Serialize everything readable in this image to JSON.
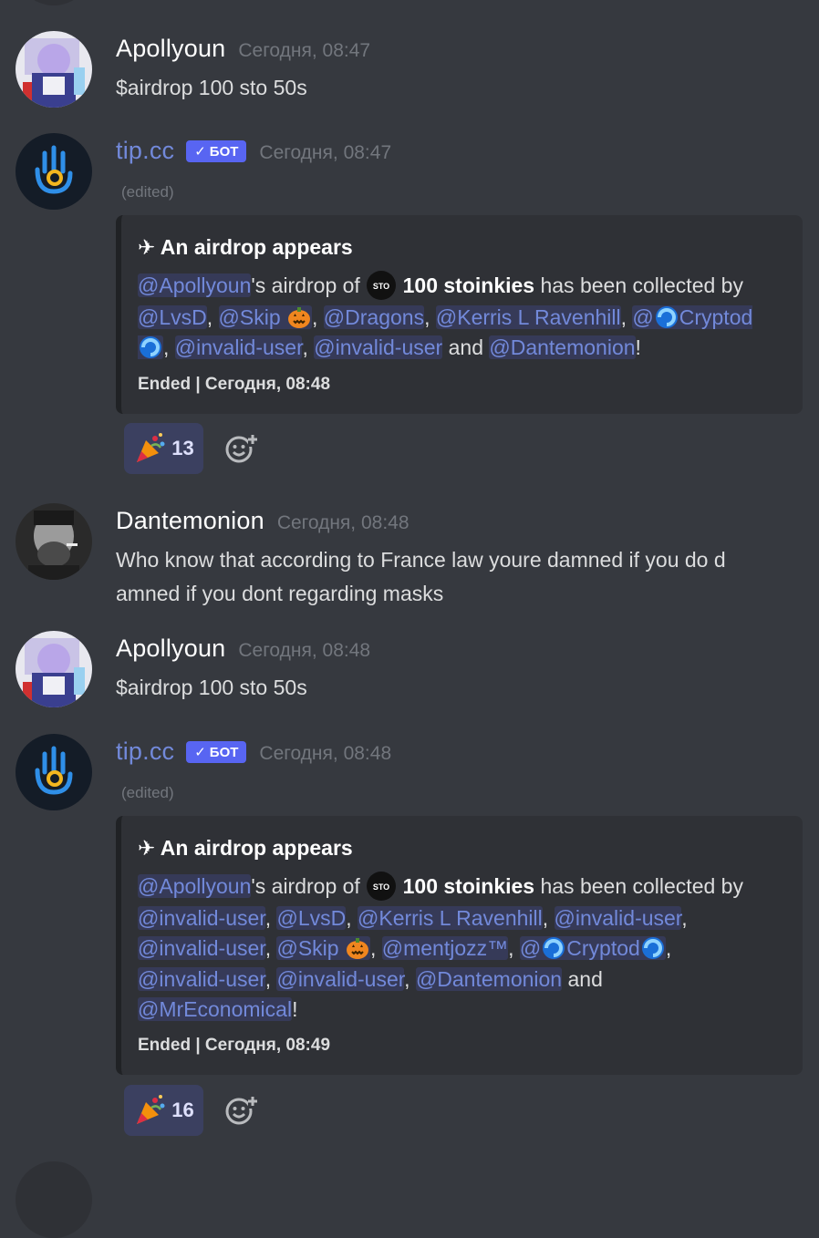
{
  "messages": [
    {
      "username": "Apollyoun",
      "timestamp": "Сегодня, 08:47",
      "text": "$airdrop 100 sto 50s"
    },
    {
      "username": "tip.cc",
      "bot_tag": "БОТ",
      "timestamp": "Сегодня, 08:47",
      "edited": "(edited)",
      "embed": {
        "title": "✈ An airdrop appears",
        "host": "@Apollyoun",
        "airdrop_of": "'s airdrop of",
        "token_icon_label": "STO",
        "amount": "100 stoinkies",
        "collected_by": "has been collected by",
        "mentions": [
          "@LvsD",
          "@Skip",
          "@Dragons",
          "@Kerris L Ravenhill",
          "@",
          "Cryptod",
          "@invalid-user",
          "@invalid-user",
          "@Dantemonion"
        ],
        "and": "and",
        "footer": "Ended | Сегодня, 08:48"
      },
      "reaction": {
        "count": "13"
      }
    },
    {
      "username": "Dantemonion",
      "timestamp": "Сегодня, 08:48",
      "text_line1": "Who know that according to France law youre damned if you do d",
      "text_line2": "amned if you dont regarding masks"
    },
    {
      "username": "Apollyoun",
      "timestamp": "Сегодня, 08:48",
      "text": "$airdrop 100 sto 50s"
    },
    {
      "username": "tip.cc",
      "bot_tag": "БОТ",
      "timestamp": "Сегодня, 08:48",
      "edited": "(edited)",
      "embed": {
        "title": "✈ An airdrop appears",
        "host": "@Apollyoun",
        "airdrop_of": "'s airdrop of",
        "token_icon_label": "STO",
        "amount": "100 stoinkies",
        "collected_by": "has been collected by",
        "mentions": [
          "@invalid-user",
          "@LvsD",
          "@Kerris L Ravenhill",
          "@invalid-user",
          "@invalid-user",
          "@Skip",
          "@mentjozz™",
          "@",
          "Cryptod",
          "@invalid-user",
          "@invalid-user",
          "@Dantemonion",
          "@MrEconomical"
        ],
        "and": "and",
        "footer": "Ended | Сегодня, 08:49"
      },
      "reaction": {
        "count": "16"
      }
    }
  ],
  "colors": {
    "background": "#36393f",
    "embed_bg": "#2f3136",
    "mention": "#7289da",
    "bot_tag": "#5865f2",
    "timestamp": "#72767d"
  },
  "icons": [
    "party-popper-icon",
    "add-reaction-icon",
    "pumpkin-icon",
    "swirl-icon",
    "sto-token-icon",
    "checkmark-icon"
  ]
}
